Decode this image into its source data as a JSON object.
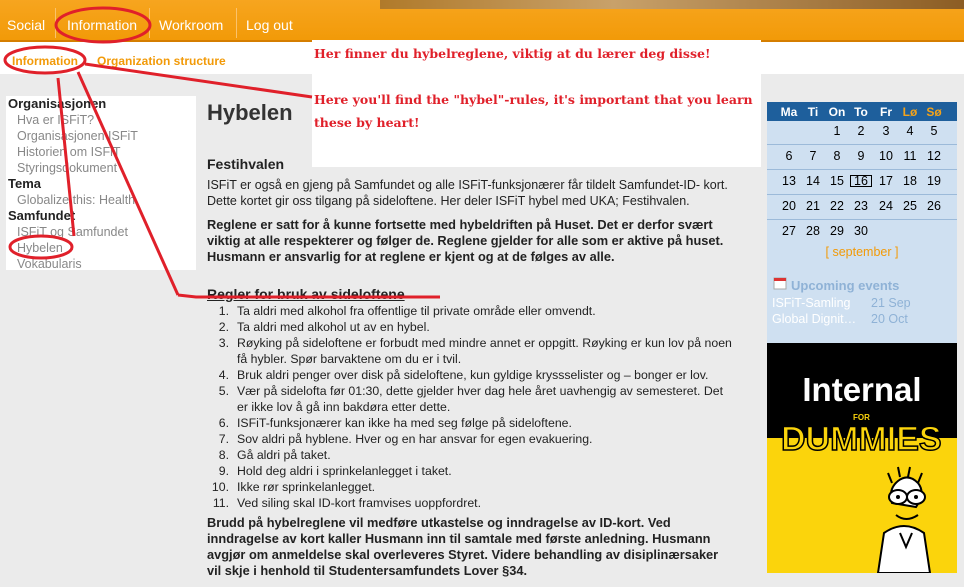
{
  "topnav": {
    "social": "Social",
    "information": "Information",
    "workroom": "Workroom",
    "logout": "Log out"
  },
  "subnav": {
    "information": "Information",
    "organization": "Organization structure"
  },
  "sidebar": {
    "groups": [
      {
        "heading": "Organisasjonen",
        "items": [
          "Hva er ISFiT?",
          "Organisasjonen ISFiT",
          "Historien om ISFiT",
          "Styringsdokument"
        ]
      },
      {
        "heading": "Tema",
        "items": [
          "Globalize this: Health"
        ]
      },
      {
        "heading": "Samfundet",
        "items": [
          "ISFiT og Samfundet",
          "Hybelen",
          "Vokabularis"
        ]
      }
    ]
  },
  "annotation": {
    "norwegian": "Her finner du hybelreglene, viktig at du lærer deg disse!",
    "english_1": "Here you'll find the \"hybel\"-rules, it's important that you learn",
    "english_2": "these by heart!"
  },
  "main": {
    "title": "Hybelen",
    "festi_heading": "Festihvalen",
    "festi_text_1": "ISFiT er også en gjeng på Samfundet og alle ISFiT-funksjonærer får tildelt Samfundet-ID- kort.",
    "festi_text_2": "Dette kortet gir oss tilgang på sideloftene. Her deler ISFiT hybel med UKA; Festihvalen.",
    "bold_1": "Reglene er satt for å kunne fortsette med hybeldriften på Huset. Det er derfor svært",
    "bold_2": "viktig at alle respekterer og følger de. Reglene gjelder for alle som er aktive på huset.",
    "bold_3": "Husmann er ansvarlig for at reglene er kjent og at de følges av alle.",
    "rules_heading": "Regler for bruk av sideloftene",
    "rules": [
      {
        "n": "1.",
        "lines": [
          "Ta aldri med alkohol fra offentlige til private område eller omvendt."
        ]
      },
      {
        "n": "2.",
        "lines": [
          "Ta aldri med alkohol ut av en hybel."
        ]
      },
      {
        "n": "3.",
        "lines": [
          "Røyking på sideloftene er forbudt med mindre annet er oppgitt. Røyking er kun lov på noen",
          "få hybler. Spør barvaktene om du er i tvil."
        ]
      },
      {
        "n": "4.",
        "lines": [
          "Bruk aldri penger over disk på sideloftene, kun gyldige kryssselister og – bonger er lov."
        ]
      },
      {
        "n": "5.",
        "lines": [
          "Vær på sidelofta før 01:30, dette gjelder hver dag hele året uavhengig av semesteret. Det",
          "er ikke lov å gå inn bakdøra etter dette."
        ]
      },
      {
        "n": "6.",
        "lines": [
          "ISFiT-funksjonærer kan ikke ha med seg følge på sideloftene."
        ]
      },
      {
        "n": "7.",
        "lines": [
          "Sov aldri på hyblene. Hver og en har ansvar for egen evakuering."
        ]
      },
      {
        "n": "8.",
        "lines": [
          "Gå aldri på taket."
        ]
      },
      {
        "n": "9.",
        "lines": [
          "Hold deg aldri i sprinkelanlegget i taket."
        ]
      },
      {
        "n": "10.",
        "lines": [
          "Ikke rør sprinkelanlegget."
        ]
      },
      {
        "n": "11.",
        "lines": [
          "Ved siling skal ID-kort framvises uoppfordret."
        ]
      }
    ],
    "footer_1": "Brudd på hybelreglene vil medføre utkastelse og inndragelse av ID-kort. Ved",
    "footer_2": "inndragelse av kort kaller Husmann inn til samtale med første anledning. Husmann",
    "footer_3": "avgjør om anmeldelse skal overleveres Styret. Videre behandling av disiplinærsaker",
    "footer_4": "vil skje i henhold til Studentersamfundets Lover §34."
  },
  "calendar": {
    "days": [
      "Ma",
      "Ti",
      "On",
      "To",
      "Fr",
      "Lø",
      "Sø"
    ],
    "weeks": [
      [
        "",
        "",
        "1",
        "2",
        "3",
        "4",
        "5"
      ],
      [
        "6",
        "7",
        "8",
        "9",
        "10",
        "11",
        "12"
      ],
      [
        "13",
        "14",
        "15",
        "16",
        "17",
        "18",
        "19"
      ],
      [
        "20",
        "21",
        "22",
        "23",
        "24",
        "25",
        "26"
      ],
      [
        "27",
        "28",
        "29",
        "30",
        "",
        "",
        ""
      ]
    ],
    "today": "16",
    "month": "[ september ]",
    "upcoming_heading": "Upcoming events",
    "events": [
      {
        "name": "ISFiT-Samling",
        "date": "21 Sep"
      },
      {
        "name": "Global Dignit…",
        "date": "20 Oct"
      }
    ]
  },
  "ad": {
    "line1": "Internal",
    "for": "FOR",
    "line2": "DUMMIES"
  },
  "colors": {
    "orange": "#f29a08",
    "blue": "#1e5f9c",
    "annotation_red": "#e0202a"
  }
}
